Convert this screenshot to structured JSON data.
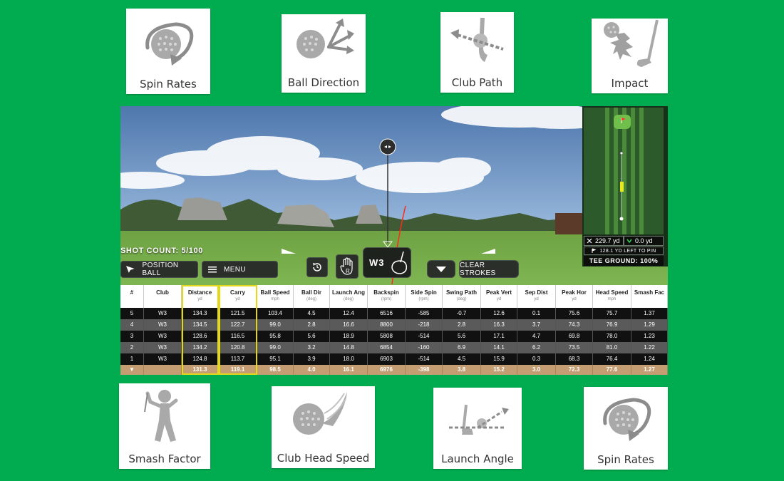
{
  "feature_cards_top": [
    {
      "label": "Spin Rates",
      "icon": "spin-rates-icon"
    },
    {
      "label": "Ball Direction",
      "icon": "ball-direction-icon"
    },
    {
      "label": "Club Path",
      "icon": "club-path-icon"
    },
    {
      "label": "Impact",
      "icon": "impact-icon"
    }
  ],
  "feature_cards_bottom": [
    {
      "label": "Smash Factor",
      "icon": "smash-factor-icon"
    },
    {
      "label": "Club Head Speed",
      "icon": "club-head-speed-icon"
    },
    {
      "label": "Launch Angle",
      "icon": "launch-angle-icon"
    },
    {
      "label": "Spin Rates",
      "icon": "spin-rates-icon"
    }
  ],
  "simulator": {
    "shot_count_label": "SHOT COUNT:",
    "shot_count_value": "5/100",
    "position_ball": "POSITION BALL",
    "menu": "MENU",
    "club": "W3",
    "hand": "R",
    "clear_strokes": "CLEAR STROKES"
  },
  "minimap": {
    "distance": "229.7 yd",
    "offline": "0.0 yd",
    "left_to_pin": "128.1 YD LEFT TO PIN",
    "tee_ground": "TEE GROUND: 100%"
  },
  "table": {
    "columns": [
      {
        "title": "#",
        "unit": ""
      },
      {
        "title": "Club",
        "unit": ""
      },
      {
        "title": "Distance",
        "unit": "yd"
      },
      {
        "title": "Carry",
        "unit": "yd"
      },
      {
        "title": "Ball Speed",
        "unit": "mph"
      },
      {
        "title": "Ball Dir",
        "unit": "(deg)"
      },
      {
        "title": "Launch Ang",
        "unit": "(deg)"
      },
      {
        "title": "Backspin",
        "unit": "(rpm)"
      },
      {
        "title": "Side Spin",
        "unit": "(rpm)"
      },
      {
        "title": "Swing Path",
        "unit": "(deg)"
      },
      {
        "title": "Peak Vert",
        "unit": "yd"
      },
      {
        "title": "Sep Dist",
        "unit": "yd"
      },
      {
        "title": "Peak Hor",
        "unit": "yd"
      },
      {
        "title": "Head Speed",
        "unit": "mph"
      },
      {
        "title": "Smash Fac",
        "unit": ""
      }
    ],
    "rows": [
      [
        "5",
        "W3",
        "134.3",
        "121.5",
        "103.4",
        "4.5",
        "12.4",
        "6516",
        "-585",
        "-0.7",
        "12.6",
        "0.1",
        "75.6",
        "75.7",
        "1.37"
      ],
      [
        "4",
        "W3",
        "134.5",
        "122.7",
        "99.0",
        "2.8",
        "16.6",
        "8800",
        "-218",
        "2.8",
        "16.3",
        "3.7",
        "74.3",
        "76.9",
        "1.29"
      ],
      [
        "3",
        "W3",
        "128.6",
        "116.5",
        "95.8",
        "5.6",
        "18.9",
        "5808",
        "-514",
        "5.6",
        "17.1",
        "4.7",
        "69.8",
        "78.0",
        "1.23"
      ],
      [
        "2",
        "W3",
        "134.2",
        "120.8",
        "99.0",
        "3.2",
        "14.8",
        "6854",
        "-160",
        "6.9",
        "14.1",
        "6.2",
        "73.5",
        "81.0",
        "1.22"
      ],
      [
        "1",
        "W3",
        "124.8",
        "113.7",
        "95.1",
        "3.9",
        "18.0",
        "6903",
        "-514",
        "4.5",
        "15.9",
        "0.3",
        "68.3",
        "76.4",
        "1.24"
      ]
    ],
    "average": [
      "▼",
      "",
      "131.3",
      "119.1",
      "98.5",
      "4.0",
      "16.1",
      "6976",
      "-398",
      "3.8",
      "15.2",
      "3.0",
      "72.3",
      "77.6",
      "1.27"
    ]
  },
  "colors": {
    "background": "#00ac4f",
    "highlight": "#e3d81a",
    "average_row": "#c49e72"
  }
}
